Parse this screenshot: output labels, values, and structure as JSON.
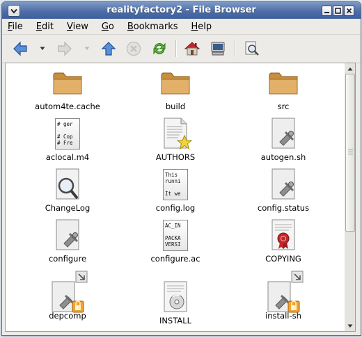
{
  "window": {
    "title": "realityfactory2 - File Browser"
  },
  "menu": [
    {
      "label": "File",
      "mnemonic": "F",
      "rest": "ile"
    },
    {
      "label": "Edit",
      "mnemonic": "E",
      "rest": "dit"
    },
    {
      "label": "View",
      "mnemonic": "V",
      "rest": "iew"
    },
    {
      "label": "Go",
      "mnemonic": "G",
      "rest": "o"
    },
    {
      "label": "Bookmarks",
      "mnemonic": "B",
      "rest": "ookmarks"
    },
    {
      "label": "Help",
      "mnemonic": "H",
      "rest": "elp"
    }
  ],
  "toolbar": {
    "buttons": [
      "back-icon",
      "forward-icon",
      "up-icon",
      "stop-icon",
      "reload-icon",
      "home-icon",
      "computer-icon",
      "search-icon"
    ]
  },
  "colors": {
    "title_bar": "#4f6ea8",
    "folder": "#d9a85a",
    "accent": "#3e5e9c"
  },
  "files": [
    {
      "name": "autom4te.cache",
      "icon": "folder-icon"
    },
    {
      "name": "build",
      "icon": "folder-icon"
    },
    {
      "name": "src",
      "icon": "folder-icon"
    },
    {
      "name": "aclocal.m4",
      "icon": "text-file-icon",
      "preview": [
        "# ger",
        "",
        "# Cop",
        "# Fre"
      ]
    },
    {
      "name": "AUTHORS",
      "icon": "authors-file-icon"
    },
    {
      "name": "autogen.sh",
      "icon": "script-icon"
    },
    {
      "name": "ChangeLog",
      "icon": "changelog-icon"
    },
    {
      "name": "config.log",
      "icon": "text-file-icon",
      "preview": [
        "This",
        "runni",
        "",
        "It we"
      ]
    },
    {
      "name": "config.status",
      "icon": "script-icon"
    },
    {
      "name": "configure",
      "icon": "script-icon"
    },
    {
      "name": "configure.ac",
      "icon": "text-file-icon",
      "preview": [
        "AC_IN",
        "",
        "PACKA",
        "VERSI"
      ]
    },
    {
      "name": "COPYING",
      "icon": "copying-icon"
    },
    {
      "name": "depcomp",
      "icon": "script-link-icon"
    },
    {
      "name": "INSTALL",
      "icon": "install-file-icon"
    },
    {
      "name": "install-sh",
      "icon": "script-link-icon"
    }
  ]
}
